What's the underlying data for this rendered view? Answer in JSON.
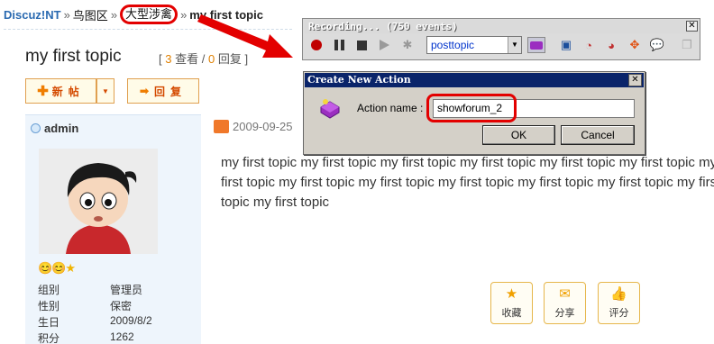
{
  "breadcrumb": {
    "home": "Discuz!NT",
    "separator": "»",
    "items": [
      "鸟图区",
      "大型涉禽"
    ],
    "current": "my first topic"
  },
  "topic": {
    "title": "my first topic",
    "stats_open": "[",
    "views": "3",
    "views_label": "查看",
    "divider": "/",
    "replies": "0",
    "replies_label": "回复",
    "stats_close": "]"
  },
  "toolbar": {
    "new_post_label": "新帖",
    "reply_label": "回复"
  },
  "author": {
    "name": "admin",
    "info": [
      {
        "key": "组别",
        "value": "管理员"
      },
      {
        "key": "性别",
        "value": "保密"
      },
      {
        "key": "生日",
        "value": "2009/8/2"
      },
      {
        "key": "积分",
        "value": "1262"
      }
    ]
  },
  "post": {
    "date": "2009-09-25",
    "body": "my first topic my first topic my first topic my first topic my first topic my first topic my first topic my first topic my first topic my first topic my first topic my first topic my first topic my first topic",
    "actions": [
      {
        "label": "收藏",
        "icon": "star-icon"
      },
      {
        "label": "分享",
        "icon": "envelope-icon"
      },
      {
        "label": "评分",
        "icon": "thumbs-up-icon"
      }
    ]
  },
  "recorder": {
    "title": "Recording... (750 events)",
    "selected_action": "posttopic"
  },
  "dialog": {
    "title": "Create New Action",
    "field_label": "Action name :",
    "field_value": "showforum_2",
    "ok_label": "OK",
    "cancel_label": "Cancel"
  },
  "colors": {
    "link": "#2a6ab1",
    "highlight": "#e30000",
    "dialog_title": "#0a246a",
    "accent_orange": "#ef7d00"
  }
}
